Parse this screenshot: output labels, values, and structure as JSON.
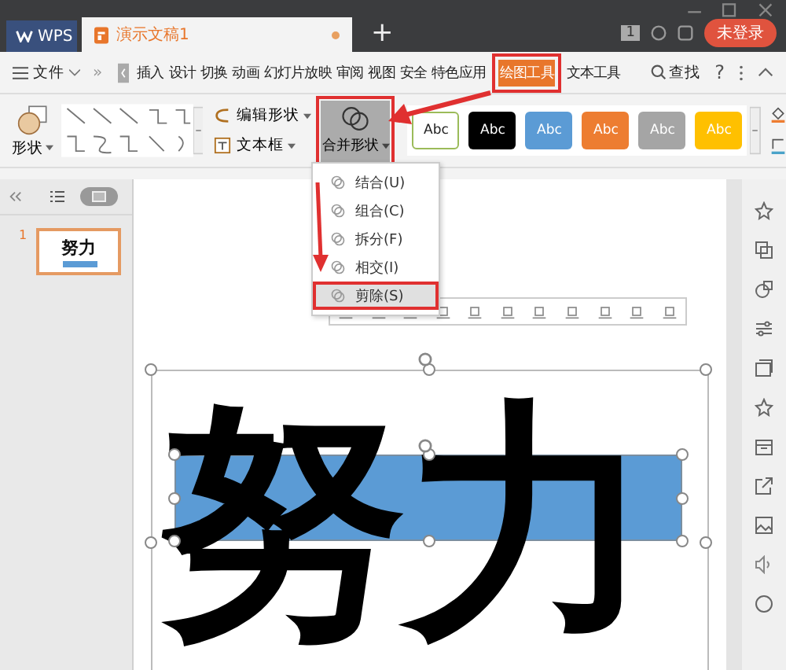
{
  "title_bar": {
    "app_tab": "WPS",
    "doc_tab": "演示文稿1",
    "new_tab": "+",
    "page_count": "1",
    "login": "未登录"
  },
  "menu": {
    "file": "文件",
    "more": "»",
    "items": [
      {
        "label": "插入",
        "selected": false
      },
      {
        "label": "设计",
        "selected": false
      },
      {
        "label": "切换",
        "selected": false
      },
      {
        "label": "动画",
        "selected": false
      },
      {
        "label": "幻灯片放映",
        "selected": false
      },
      {
        "label": "审阅",
        "selected": false
      },
      {
        "label": "视图",
        "selected": false
      },
      {
        "label": "安全",
        "selected": false
      },
      {
        "label": "特色应用",
        "selected": false
      },
      {
        "label": "绘图工具",
        "selected": true
      },
      {
        "label": "文本工具",
        "selected": false
      }
    ],
    "search": "查找",
    "help": "?"
  },
  "ribbon": {
    "shape": "形状",
    "edit_shape": "编辑形状",
    "text_box": "文本框",
    "merge_shapes": "合并形状",
    "styles": [
      {
        "label": "Abc",
        "kind": "outline",
        "color": "#ffffff"
      },
      {
        "label": "Abc",
        "kind": "filled",
        "color": "#000000"
      },
      {
        "label": "Abc",
        "kind": "filled",
        "color": "#5b9bd5"
      },
      {
        "label": "Abc",
        "kind": "filled",
        "color": "#ed7d31"
      },
      {
        "label": "Abc",
        "kind": "filled",
        "color": "#a5a5a5"
      },
      {
        "label": "Abc",
        "kind": "filled",
        "color": "#ffc000"
      }
    ]
  },
  "merge_menu": [
    {
      "label": "结合(U)",
      "selected": false
    },
    {
      "label": "组合(C)",
      "selected": false
    },
    {
      "label": "拆分(F)",
      "selected": false
    },
    {
      "label": "相交(I)",
      "selected": false
    },
    {
      "label": "剪除(S)",
      "selected": true
    }
  ],
  "slides": [
    {
      "number": "1",
      "selected": true,
      "text": "努力"
    }
  ],
  "slide": {
    "text": "努力"
  }
}
